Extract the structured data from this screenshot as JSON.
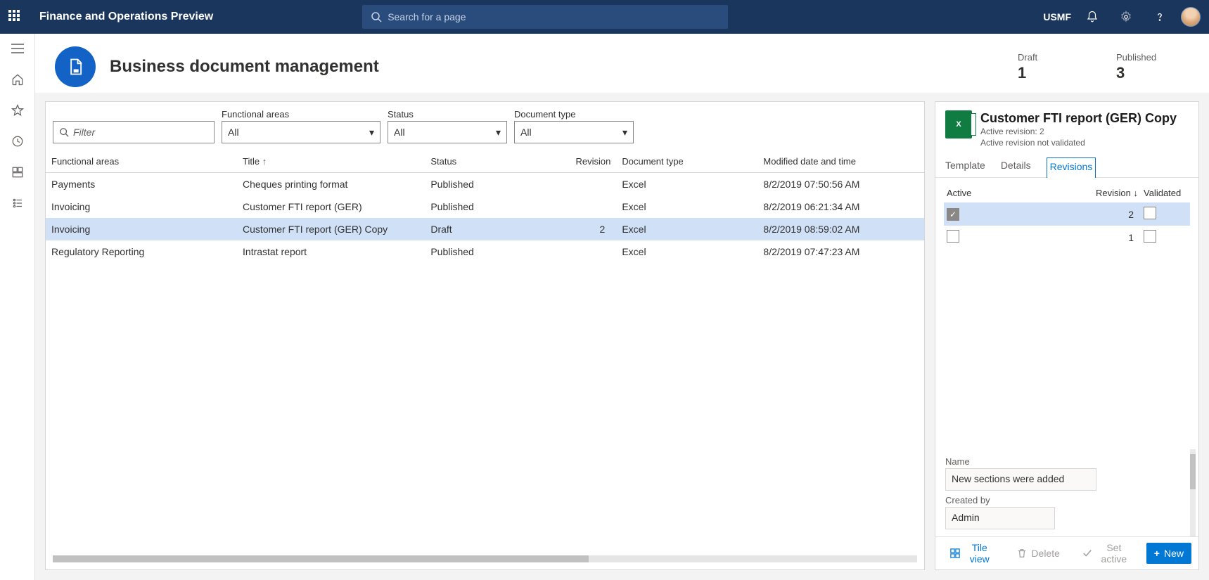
{
  "topnav": {
    "app_name": "Finance and Operations Preview",
    "search_placeholder": "Search for a page",
    "entity": "USMF"
  },
  "page": {
    "title": "Business document management",
    "stats": {
      "draft_label": "Draft",
      "draft_value": "1",
      "published_label": "Published",
      "published_value": "3"
    }
  },
  "filters": {
    "filter_placeholder": "Filter",
    "functional_areas": {
      "label": "Functional areas",
      "value": "All"
    },
    "status": {
      "label": "Status",
      "value": "All"
    },
    "document_type": {
      "label": "Document type",
      "value": "All"
    }
  },
  "grid": {
    "columns": {
      "functional_areas": "Functional areas",
      "title": "Title",
      "status": "Status",
      "revision": "Revision",
      "document_type": "Document type",
      "modified": "Modified date and time"
    },
    "rows": [
      {
        "fa": "Payments",
        "title": "Cheques printing format",
        "status": "Published",
        "rev": "",
        "doctype": "Excel",
        "mod": "8/2/2019 07:50:56 AM",
        "sel": false
      },
      {
        "fa": "Invoicing",
        "title": "Customer FTI report (GER)",
        "status": "Published",
        "rev": "",
        "doctype": "Excel",
        "mod": "8/2/2019 06:21:34 AM",
        "sel": false
      },
      {
        "fa": "Invoicing",
        "title": "Customer FTI report (GER) Copy",
        "status": "Draft",
        "rev": "2",
        "doctype": "Excel",
        "mod": "8/2/2019 08:59:02 AM",
        "sel": true
      },
      {
        "fa": "Regulatory Reporting",
        "title": "Intrastat report",
        "status": "Published",
        "rev": "",
        "doctype": "Excel",
        "mod": "8/2/2019 07:47:23 AM",
        "sel": false
      }
    ]
  },
  "detail": {
    "title": "Customer FTI report (GER) Copy",
    "sub1": "Active revision: 2",
    "sub2": "Active revision not validated",
    "tabs": {
      "template": "Template",
      "details": "Details",
      "revisions": "Revisions"
    },
    "rev_columns": {
      "active": "Active",
      "revision": "Revision",
      "validated": "Validated"
    },
    "rev_rows": [
      {
        "active": true,
        "rev": "2",
        "validated": false,
        "sel": true
      },
      {
        "active": false,
        "rev": "1",
        "validated": false,
        "sel": false
      }
    ],
    "name_label": "Name",
    "name_value": "New sections were added",
    "createdby_label": "Created by",
    "createdby_value": "Admin",
    "toolbar": {
      "tile": "Tile view",
      "delete": "Delete",
      "setactive": "Set active",
      "new": "New"
    }
  }
}
